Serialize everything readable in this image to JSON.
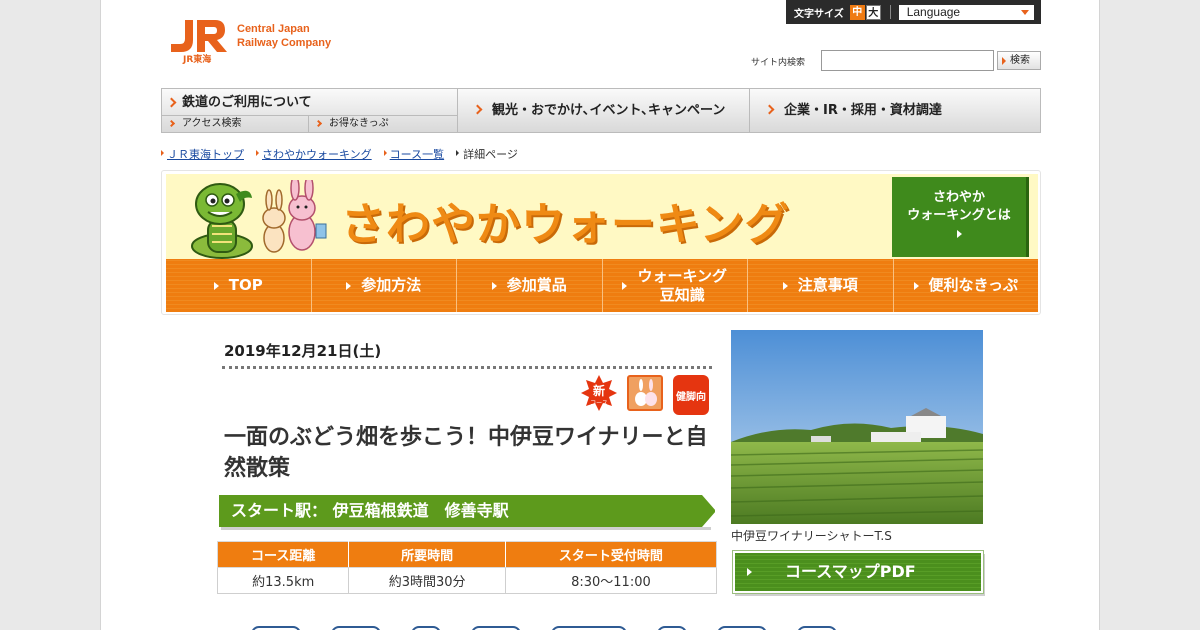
{
  "header": {
    "logo_text_line1": "Central Japan",
    "logo_text_line2": "Railway Company",
    "logo_caption": "JR東海",
    "font_size_label": "文字サイズ",
    "font_size_mid": "中",
    "font_size_large": "大",
    "language_label": "Language",
    "search_label": "サイト内検索",
    "search_placeholder": "",
    "search_button": "検索"
  },
  "global_nav": {
    "item1": "鉄道のご利用について",
    "item1_sub1": "アクセス検索",
    "item1_sub2": "お得なきっぷ",
    "item2": "観光・おでかけ､イベント､キャンペーン",
    "item3": "企業・IR・採用・資材調達"
  },
  "breadcrumb": {
    "items": [
      "ＪＲ東海トップ",
      "さわやかウォーキング",
      "コース一覧"
    ],
    "current": "詳細ページ"
  },
  "banner": {
    "title": "さわやかウォーキング",
    "what_line1": "さわやか",
    "what_line2": "ウォーキングとは"
  },
  "sub_nav": {
    "top": "TOP",
    "how": "参加方法",
    "prizes": "参加賞品",
    "knowledge_line1": "ウォーキング",
    "knowledge_line2": "豆知識",
    "notes": "注意事項",
    "tickets": "便利なきっぷ"
  },
  "course": {
    "date": "2019年12月21日(土)",
    "badge_new": "新",
    "badge_new_sub": "コース",
    "badge_kenkyaku": "健脚向",
    "title": "一面のぶどう畑を歩こう！中伊豆ワイナリーと自然散策",
    "start_station": "スタート駅： 伊豆箱根鉄道　修善寺駅",
    "table_headers": [
      "コース距離",
      "所要時間",
      "スタート受付時間"
    ],
    "table_values": [
      "約13.5km",
      "約3時間30分",
      "8:30～11:00"
    ],
    "photo_caption": "中伊豆ワイナリーシャトーT.S",
    "map_button": "コースマップPDF"
  },
  "colors": {
    "accent_orange": "#ef7d10",
    "brand_jr": "#e8621c",
    "green": "#5d9a1c"
  }
}
